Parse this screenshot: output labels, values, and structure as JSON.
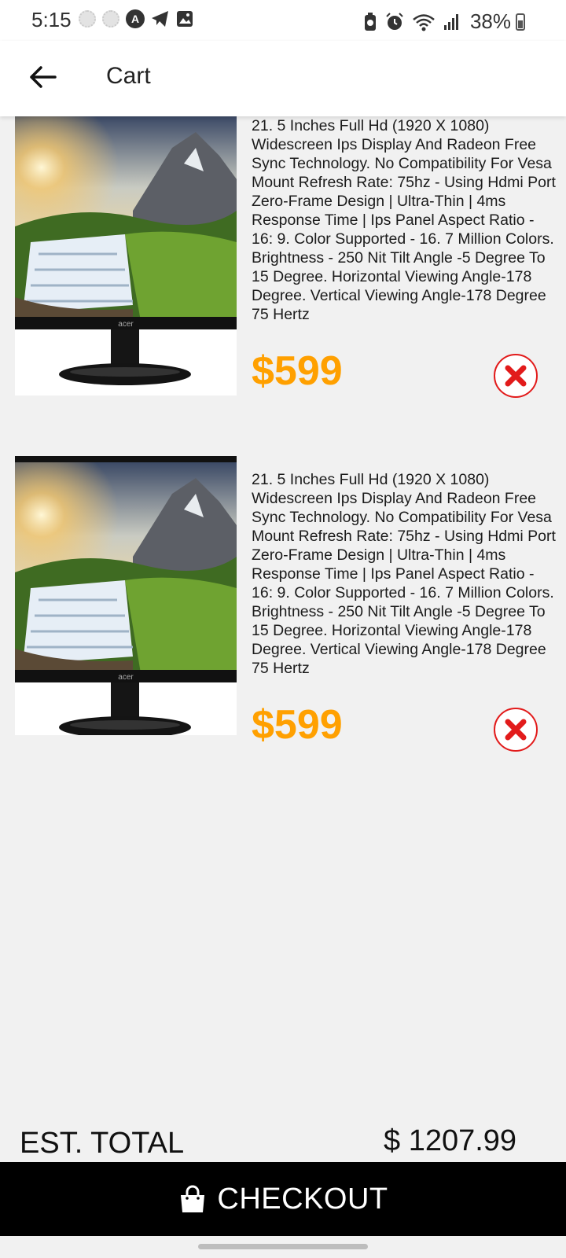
{
  "status_bar": {
    "time": "5:15",
    "battery": "38%",
    "icons": [
      "dot-icon",
      "dot-icon",
      "a-icon",
      "telegram-icon",
      "image-icon",
      "battery-saver-icon",
      "alarm-icon",
      "wifi-icon",
      "signal-icon",
      "battery-icon"
    ]
  },
  "header": {
    "title": "Cart",
    "back_icon": "arrow-left-icon"
  },
  "cart": {
    "items": [
      {
        "description": "21. 5 Inches Full Hd (1920 X 1080) Widescreen Ips Display And Radeon Free Sync Technology. No Compatibility For Vesa Mount Refresh Rate: 75hz - Using Hdmi Port Zero-Frame Design | Ultra-Thin | 4ms Response Time | Ips Panel Aspect Ratio - 16: 9. Color Supported - 16. 7 Million Colors. Brightness - 250 Nit Tilt Angle -5 Degree To 15 Degree. Horizontal Viewing Angle-178 Degree. Vertical Viewing Angle-178 Degree 75 Hertz",
        "price": "$599",
        "brand": "acer",
        "remove_icon": "close-circle-icon"
      },
      {
        "description": "21. 5 Inches Full Hd (1920 X 1080) Widescreen Ips Display And Radeon Free Sync Technology. No Compatibility For Vesa Mount Refresh Rate: 75hz - Using Hdmi Port Zero-Frame Design | Ultra-Thin | 4ms Response Time | Ips Panel Aspect Ratio - 16: 9. Color Supported - 16. 7 Million Colors. Brightness - 250 Nit Tilt Angle -5 Degree To 15 Degree. Horizontal Viewing Angle-178 Degree. Vertical Viewing Angle-178 Degree 75 Hertz",
        "price": "$599",
        "brand": "acer",
        "remove_icon": "close-circle-icon"
      }
    ]
  },
  "summary": {
    "total_label": "EST. TOTAL",
    "total_value": "$ 1207.99"
  },
  "checkout": {
    "label": "CHECKOUT",
    "icon": "shopping-bag-icon"
  },
  "colors": {
    "price": "#ffa000",
    "remove": "#e21b1b",
    "checkout_bg": "#000000",
    "page_bg": "#f1f1f1"
  }
}
